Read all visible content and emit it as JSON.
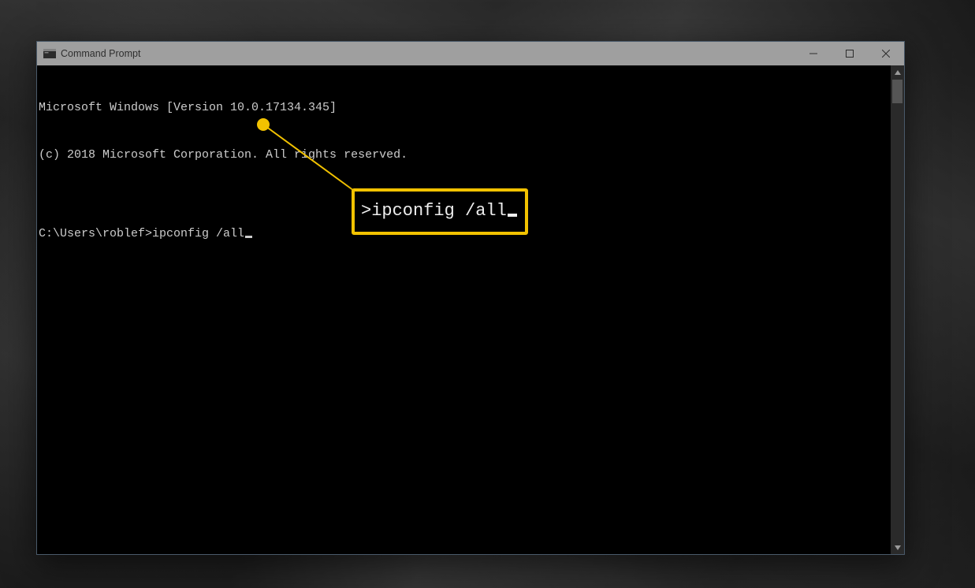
{
  "window": {
    "title": "Command Prompt"
  },
  "terminal": {
    "line1": "Microsoft Windows [Version 10.0.17134.345]",
    "line2": "(c) 2018 Microsoft Corporation. All rights reserved.",
    "blank": "",
    "prompt_prefix": "C:\\Users\\roblef>",
    "command": "ipconfig /all"
  },
  "callout": {
    "text": ">ipconfig /all"
  },
  "colors": {
    "annotation": "#f2c200"
  }
}
